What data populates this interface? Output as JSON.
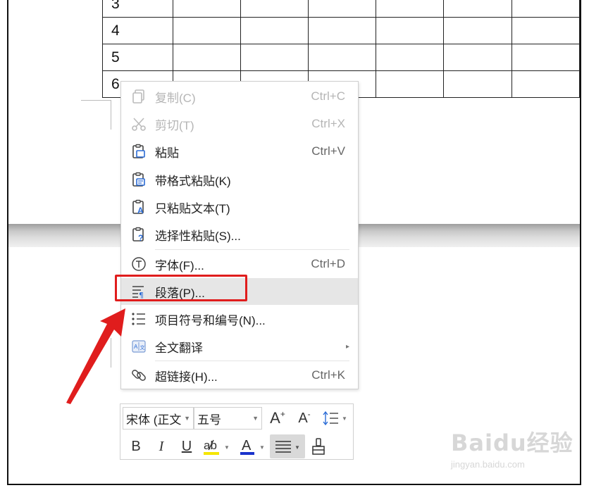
{
  "table": {
    "rows": [
      [
        "3",
        "",
        "",
        "",
        "",
        "",
        ""
      ],
      [
        "4",
        "",
        "",
        "",
        "",
        "",
        ""
      ],
      [
        "5",
        "",
        "",
        "",
        "",
        "",
        ""
      ],
      [
        "6",
        "",
        "",
        "",
        "",
        "",
        ""
      ]
    ]
  },
  "context_menu": {
    "copy": {
      "label": "复制(C)",
      "shortcut": "Ctrl+C",
      "icon": "copy-icon"
    },
    "cut": {
      "label": "剪切(T)",
      "shortcut": "Ctrl+X",
      "icon": "scissors-icon"
    },
    "paste": {
      "label": "粘贴",
      "shortcut": "Ctrl+V",
      "icon": "clipboard-icon"
    },
    "paste_format": {
      "label": "带格式粘贴(K)",
      "icon": "clipboard-format-icon"
    },
    "paste_text": {
      "label": "只粘贴文本(T)",
      "icon": "clipboard-text-icon"
    },
    "paste_special": {
      "label": "选择性粘贴(S)...",
      "icon": "clipboard-question-icon"
    },
    "font": {
      "label": "字体(F)...",
      "shortcut": "Ctrl+D",
      "icon": "font-circle-icon"
    },
    "paragraph": {
      "label": "段落(P)...",
      "icon": "paragraph-icon"
    },
    "bullets": {
      "label": "项目符号和编号(N)...",
      "icon": "list-icon"
    },
    "translate": {
      "label": "全文翻译",
      "icon": "translate-icon"
    },
    "hyperlink": {
      "label": "超链接(H)...",
      "shortcut": "Ctrl+K",
      "icon": "link-icon"
    }
  },
  "mini_toolbar": {
    "font_name": "宋体 (正文",
    "font_size": "五号",
    "bold": "B",
    "italic": "I",
    "underline": "U",
    "font_color_letter": "A",
    "grow_letter": "A",
    "shrink_letter": "A"
  },
  "watermark": {
    "brand": "Baidu经验",
    "url": "jingyan.baidu.com"
  },
  "colors": {
    "highlight_box": "#e01d1d",
    "arrow": "#e01d1d",
    "menu_hover": "#e6e6e6",
    "font_color_bar": "#1a33cc",
    "highlight_bar": "#f5e600"
  }
}
